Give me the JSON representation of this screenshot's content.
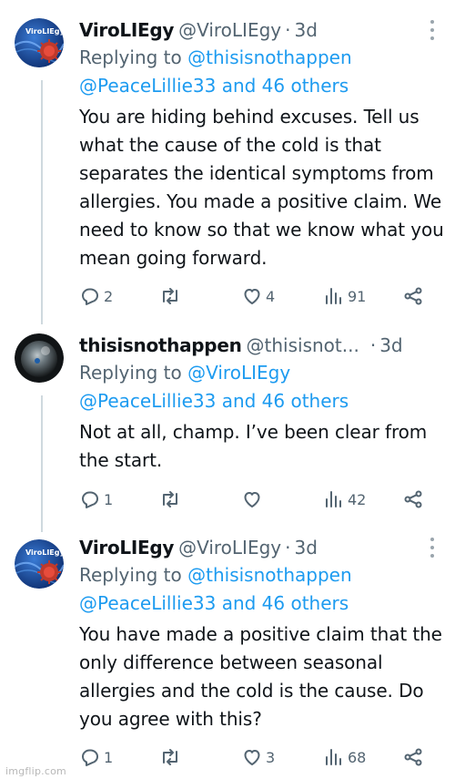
{
  "tweets": [
    {
      "author_name": "ViroLIEgy",
      "author_handle": "@ViroLIEgy",
      "separator": "·",
      "time": "3d",
      "avatar_label": "ViroLIEgy",
      "replying_prefix": "Replying to",
      "replying_to_line1": "@thisisnothappen",
      "replying_to_line2": "@PeaceLillie33 and 46 others",
      "text": "You are hiding behind excuses. Tell us what the cause of the cold is that separates the identical symptoms from allergies. You made a positive claim. We need to know so that we know what you mean going forward.",
      "replies": "2",
      "retweets": "",
      "likes": "4",
      "views": "91"
    },
    {
      "author_name": "thisisnothappen",
      "author_handle": "@thisisnot...",
      "separator": "·",
      "time": "3d",
      "replying_prefix": "Replying to",
      "replying_to_line1": "@ViroLIEgy",
      "replying_to_line2": "@PeaceLillie33 and 46 others",
      "text": "Not at all, champ. I’ve been clear from the start.",
      "replies": "1",
      "retweets": "",
      "likes": "",
      "views": "42"
    },
    {
      "author_name": "ViroLIEgy",
      "author_handle": "@ViroLIEgy",
      "separator": "·",
      "time": "3d",
      "avatar_label": "ViroLIEgy",
      "replying_prefix": "Replying to",
      "replying_to_line1": "@thisisnothappen",
      "replying_to_line2": "@PeaceLillie33 and 46 others",
      "text": "You have made a positive claim that the only difference between seasonal allergies and the cold is the cause. Do you agree with this?",
      "replies": "1",
      "retweets": "",
      "likes": "3",
      "views": "68"
    }
  ],
  "watermark": "imgflip.com",
  "colors": {
    "link": "#1d9bf0",
    "muted": "#536471",
    "text": "#0f1419",
    "thread_line": "#cfd9de"
  },
  "icons": [
    "reply-icon",
    "retweet-icon",
    "like-icon",
    "views-icon",
    "share-icon",
    "more-icon"
  ]
}
